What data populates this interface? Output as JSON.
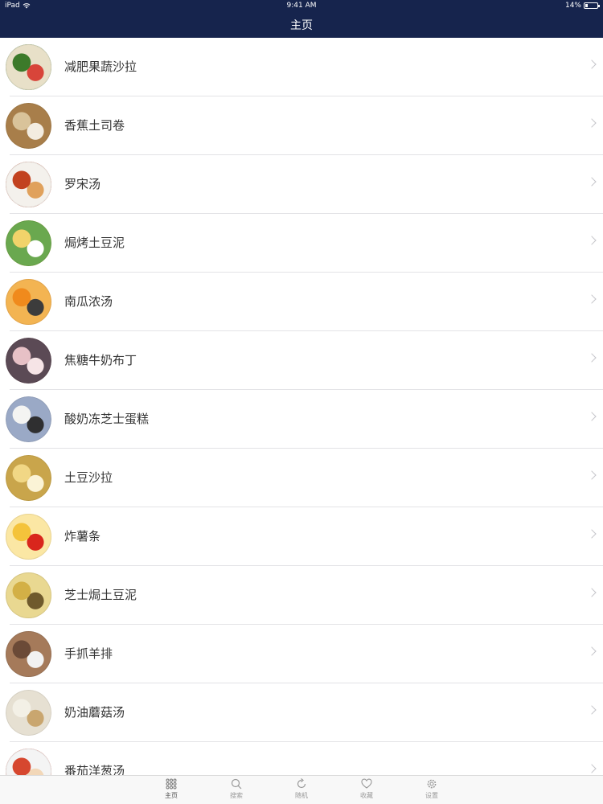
{
  "status_bar": {
    "carrier": "iPad",
    "time": "9:41 AM",
    "battery": "14%"
  },
  "nav": {
    "title": "主页"
  },
  "recipes": [
    {
      "name": "减肥果蔬沙拉",
      "thumb": "salad-thumbnail",
      "colors": [
        "#3c7a2a",
        "#d8453a",
        "#e8e0c8"
      ]
    },
    {
      "name": "香蕉土司卷",
      "thumb": "toast-roll-thumbnail",
      "colors": [
        "#d9c39a",
        "#f3ece0",
        "#a87e4a"
      ]
    },
    {
      "name": "罗宋汤",
      "thumb": "borscht-thumbnail",
      "colors": [
        "#c2421f",
        "#e0a15c",
        "#f4f1ec"
      ]
    },
    {
      "name": "焗烤土豆泥",
      "thumb": "baked-mashed-potato-thumbnail",
      "colors": [
        "#f1d36a",
        "#ffffff",
        "#6aa84f"
      ]
    },
    {
      "name": "南瓜浓汤",
      "thumb": "pumpkin-soup-thumbnail",
      "colors": [
        "#f08a1c",
        "#3c3c3c",
        "#f3b452"
      ]
    },
    {
      "name": "焦糖牛奶布丁",
      "thumb": "caramel-pudding-thumbnail",
      "colors": [
        "#e7c1c6",
        "#f6e4e6",
        "#5b4a55"
      ]
    },
    {
      "name": "酸奶冻芝士蛋糕",
      "thumb": "cheesecake-thumbnail",
      "colors": [
        "#f4f4f2",
        "#2f2f30",
        "#9aa9c6"
      ]
    },
    {
      "name": "土豆沙拉",
      "thumb": "potato-salad-thumbnail",
      "colors": [
        "#f1d785",
        "#fbf3d6",
        "#c9a54b"
      ]
    },
    {
      "name": "炸薯条",
      "thumb": "french-fries-thumbnail",
      "colors": [
        "#f4c33b",
        "#d9261c",
        "#fbe7a4"
      ]
    },
    {
      "name": "芝士焗土豆泥",
      "thumb": "cheese-baked-potato-thumbnail",
      "colors": [
        "#d3b046",
        "#6f5a2c",
        "#e9d891"
      ]
    },
    {
      "name": "手抓羊排",
      "thumb": "lamb-chops-thumbnail",
      "colors": [
        "#6b4a37",
        "#f2f2f2",
        "#a57a5a"
      ]
    },
    {
      "name": "奶油蘑菇汤",
      "thumb": "mushroom-soup-thumbnail",
      "colors": [
        "#f3f0e6",
        "#c9a66f",
        "#e6e0d2"
      ]
    },
    {
      "name": "番茄洋葱汤",
      "thumb": "tomato-onion-soup-thumbnail",
      "colors": [
        "#d6472f",
        "#f2d7b8",
        "#f4f4f4"
      ]
    }
  ],
  "tab_bar": {
    "tabs": [
      {
        "label": "主页",
        "icon": "grid-icon",
        "active": true
      },
      {
        "label": "搜索",
        "icon": "search-icon",
        "active": false
      },
      {
        "label": "随机",
        "icon": "refresh-icon",
        "active": false
      },
      {
        "label": "收藏",
        "icon": "heart-icon",
        "active": false
      },
      {
        "label": "设置",
        "icon": "gear-icon",
        "active": false
      }
    ]
  }
}
